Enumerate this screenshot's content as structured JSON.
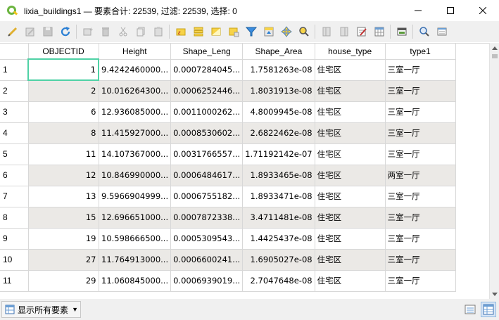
{
  "window": {
    "title": "lixia_buildings1 — 要素合计: 22539, 过滤: 22539, 选择: 0"
  },
  "toolbar": {
    "buttons": [
      "toggle-editing-icon",
      "multi-edit-icon",
      "save-edits-icon",
      "reload-icon",
      "add-feature-icon",
      "delete-feature-icon",
      "cut-icon",
      "copy-icon",
      "paste-icon",
      "select-by-expression-icon",
      "select-all-icon",
      "invert-selection-icon",
      "deselect-icon",
      "filter-icon",
      "move-selection-top-icon",
      "pan-to-selection-icon",
      "zoom-to-selection-icon",
      "new-field-icon",
      "delete-field-icon",
      "field-calculator-icon",
      "conditional-format-icon",
      "dock-icon",
      "actions-icon",
      "form-view-icon"
    ]
  },
  "table": {
    "columns": [
      "OBJECTID",
      "Height",
      "Shape_Leng",
      "Shape_Area",
      "house_type",
      "type1"
    ],
    "rows": [
      {
        "n": "1",
        "objectid": "1",
        "height": "9.4242460000...",
        "leng": "0.0007284045...",
        "area": "1.7581263e-08",
        "house": "住宅区",
        "type1": "三室一厅"
      },
      {
        "n": "2",
        "objectid": "2",
        "height": "10.016264300...",
        "leng": "0.0006252446...",
        "area": "1.8031913e-08",
        "house": "住宅区",
        "type1": "三室一厅"
      },
      {
        "n": "3",
        "objectid": "6",
        "height": "12.936085000...",
        "leng": "0.0011000262...",
        "area": "4.8009945e-08",
        "house": "住宅区",
        "type1": "三室一厅"
      },
      {
        "n": "4",
        "objectid": "8",
        "height": "11.415927000...",
        "leng": "0.0008530602...",
        "area": "2.6822462e-08",
        "house": "住宅区",
        "type1": "三室一厅"
      },
      {
        "n": "5",
        "objectid": "11",
        "height": "14.107367000...",
        "leng": "0.0031766557...",
        "area": "1.71192142e-07",
        "house": "住宅区",
        "type1": "三室一厅"
      },
      {
        "n": "6",
        "objectid": "12",
        "height": "10.846990000...",
        "leng": "0.0006484617...",
        "area": "1.8933465e-08",
        "house": "住宅区",
        "type1": "两室一厅"
      },
      {
        "n": "7",
        "objectid": "13",
        "height": "9.5966904999...",
        "leng": "0.0006755182...",
        "area": "1.8933471e-08",
        "house": "住宅区",
        "type1": "三室一厅"
      },
      {
        "n": "8",
        "objectid": "15",
        "height": "12.696651000...",
        "leng": "0.0007872338...",
        "area": "3.4711481e-08",
        "house": "住宅区",
        "type1": "三室一厅"
      },
      {
        "n": "9",
        "objectid": "19",
        "height": "10.598666500...",
        "leng": "0.0005309543...",
        "area": "1.4425437e-08",
        "house": "住宅区",
        "type1": "三室一厅"
      },
      {
        "n": "10",
        "objectid": "27",
        "height": "11.764913000...",
        "leng": "0.0006600241...",
        "area": "1.6905027e-08",
        "house": "住宅区",
        "type1": "三室一厅"
      },
      {
        "n": "11",
        "objectid": "29",
        "height": "11.060845000...",
        "leng": "0.0006939019...",
        "area": "2.7047648e-08",
        "house": "住宅区",
        "type1": "三室一厅"
      }
    ]
  },
  "bottom": {
    "filter_label": "显示所有要素"
  },
  "colors": {
    "alt_row": "#ebe9e6",
    "selected_border": "#4fd1a5",
    "toolbar_bg": "#f0f0f0"
  }
}
